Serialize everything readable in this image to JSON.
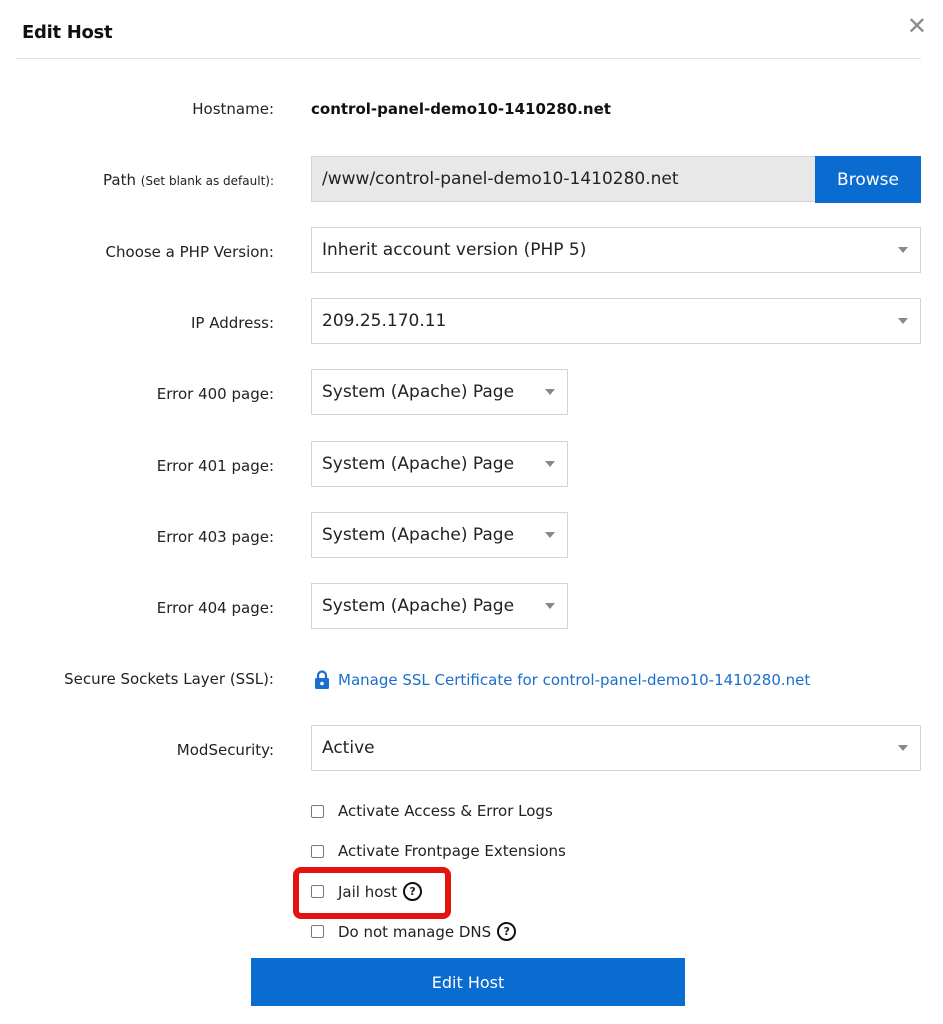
{
  "dialog": {
    "title": "Edit Host",
    "close_icon": "close-icon"
  },
  "form": {
    "hostname": {
      "label": "Hostname:",
      "value": "control-panel-demo10-1410280.net"
    },
    "path": {
      "label": "Path",
      "hint": "(Set blank as default):",
      "value": "/www/control-panel-demo10-1410280.net",
      "browse_label": "Browse"
    },
    "php_version": {
      "label": "Choose a PHP Version:",
      "value": "Inherit account version (PHP 5)"
    },
    "ip_address": {
      "label": "IP Address:",
      "value": "209.25.170.11"
    },
    "error_pages": [
      {
        "label": "Error 400 page:",
        "value": "System (Apache) Page"
      },
      {
        "label": "Error 401 page:",
        "value": "System (Apache) Page"
      },
      {
        "label": "Error 403 page:",
        "value": "System (Apache) Page"
      },
      {
        "label": "Error 404 page:",
        "value": "System (Apache) Page"
      }
    ],
    "ssl": {
      "label": "Secure Sockets Layer (SSL):",
      "link_text": "Manage SSL Certificate for control-panel-demo10-1410280.net",
      "icon": "lock-icon"
    },
    "modsecurity": {
      "label": "ModSecurity:",
      "value": "Active"
    },
    "checkboxes": [
      {
        "label": "Activate Access & Error Logs",
        "checked": false,
        "help": false
      },
      {
        "label": "Activate Frontpage Extensions",
        "checked": false,
        "help": false
      },
      {
        "label": "Jail host",
        "checked": false,
        "help": true
      },
      {
        "label": "Do not manage DNS",
        "checked": false,
        "help": true
      }
    ],
    "help_glyph": "?",
    "submit_label": "Edit Host"
  },
  "colors": {
    "primary": "#0a6bd1",
    "link": "#1a6fcc",
    "highlight": "#e3140f"
  }
}
